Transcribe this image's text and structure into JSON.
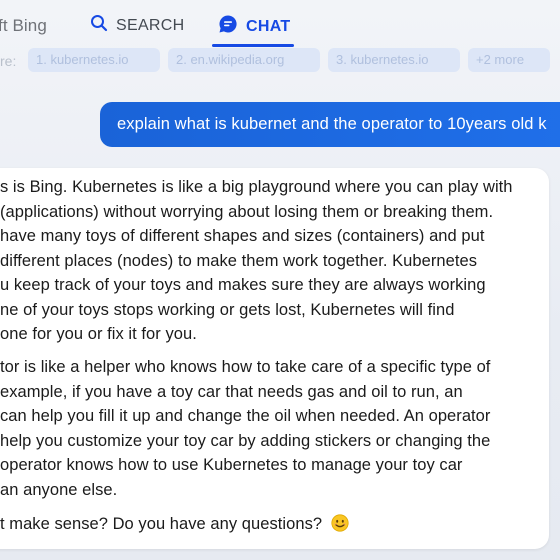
{
  "header": {
    "brand": "ft Bing",
    "tabs": [
      {
        "label": "SEARCH",
        "active": false
      },
      {
        "label": "CHAT",
        "active": true
      }
    ],
    "accent_color": "#174ae4"
  },
  "sources": {
    "prefix": "re:",
    "chips": [
      "1. kubernetes.io",
      "2. en.wikipedia.org",
      "3. kubernetes.io",
      "+2 more"
    ]
  },
  "conversation": {
    "user_message": "explain what is kubernet and the operator to 10years old k",
    "response": {
      "paragraph1": [
        "s is Bing. Kubernetes is like a big playground where you can play with",
        " (applications) without worrying about losing them or breaking them.",
        "have many toys of different shapes and sizes (containers) and put",
        "different places (nodes) to make them work together. Kubernetes",
        "u keep track of your toys and makes sure they are always working",
        "ne of your toys stops working or gets lost, Kubernetes will find",
        "one for you or fix it for you."
      ],
      "paragraph2": [
        "tor is like a helper who knows how to take care of a specific type of",
        "example, if you have a toy car that needs gas and oil to run, an",
        "can help you fill it up and change the oil when needed. An operator",
        "help you customize your toy car by adding stickers or changing the",
        " operator knows how to use Kubernetes to manage your toy car",
        "an anyone else."
      ],
      "closing": "t make sense? Do you have any questions?",
      "closing_emoji": "smiling-face-icon"
    }
  }
}
